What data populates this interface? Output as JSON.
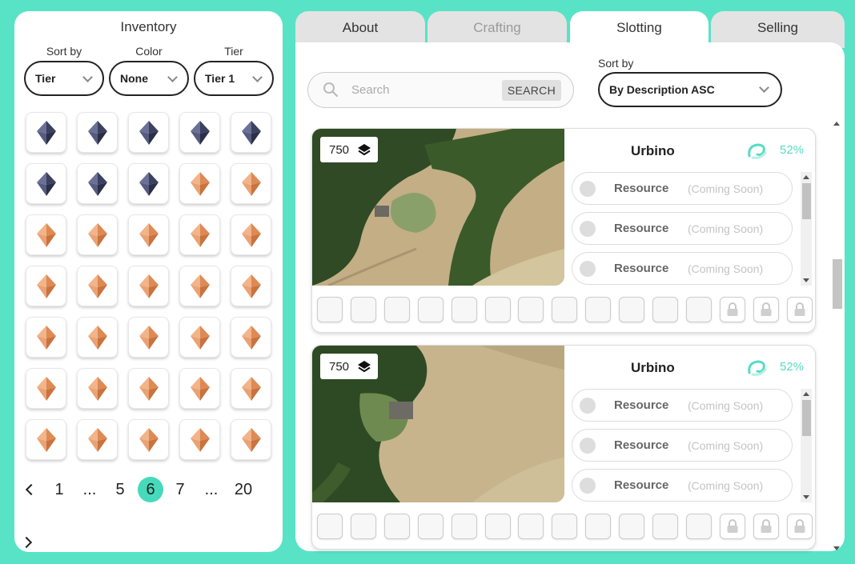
{
  "inventory": {
    "title": "Inventory",
    "filters": [
      {
        "label": "Sort by",
        "value": "Tier"
      },
      {
        "label": "Color",
        "value": "None"
      },
      {
        "label": "Tier",
        "value": "Tier 1"
      }
    ],
    "grid": [
      [
        "dark",
        "dark",
        "dark",
        "dark",
        "dark"
      ],
      [
        "dark",
        "dark",
        "dark",
        "orange",
        "orange"
      ],
      [
        "orange",
        "orange",
        "orange",
        "orange",
        "orange"
      ],
      [
        "orange",
        "orange",
        "orange",
        "orange",
        "orange"
      ],
      [
        "orange",
        "orange",
        "orange",
        "orange",
        "orange"
      ],
      [
        "orange",
        "orange",
        "orange",
        "orange",
        "orange"
      ],
      [
        "orange",
        "orange",
        "orange",
        "orange",
        "orange"
      ]
    ],
    "gem_colors": {
      "dark": "#4a4f70",
      "orange": "#e0905c"
    },
    "pagination": {
      "pages": [
        "1",
        "...",
        "5",
        "6",
        "7",
        "...",
        "20"
      ],
      "current": "6"
    }
  },
  "tabs": [
    {
      "label": "About",
      "state": "normal"
    },
    {
      "label": "Crafting",
      "state": "disabled"
    },
    {
      "label": "Slotting",
      "state": "active"
    },
    {
      "label": "Selling",
      "state": "normal"
    }
  ],
  "search": {
    "placeholder": "Search",
    "button": "SEARCH"
  },
  "sort": {
    "label": "Sort by",
    "value": "By Description ASC"
  },
  "cards": [
    {
      "amount": "750",
      "title": "Urbino",
      "percent": "52%",
      "resources": [
        {
          "name": "Resource",
          "status": "(Coming Soon)"
        },
        {
          "name": "Resource",
          "status": "(Coming Soon)"
        },
        {
          "name": "Resource",
          "status": "(Coming Soon)"
        }
      ],
      "empty_slots": 12,
      "locked_slots": 3
    },
    {
      "amount": "750",
      "title": "Urbino",
      "percent": "52%",
      "resources": [
        {
          "name": "Resource",
          "status": "(Coming Soon)"
        },
        {
          "name": "Resource",
          "status": "(Coming Soon)"
        },
        {
          "name": "Resource",
          "status": "(Coming Soon)"
        }
      ],
      "empty_slots": 12,
      "locked_slots": 3
    }
  ],
  "colors": {
    "accent": "#47d9bb",
    "frame": "#58e3c6"
  }
}
